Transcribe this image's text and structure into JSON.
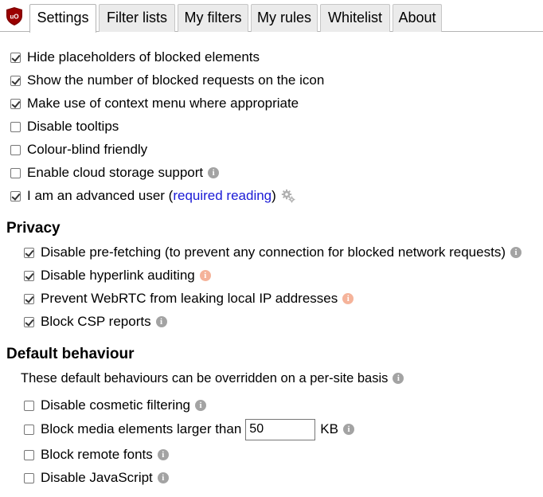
{
  "tabs": [
    {
      "label": "Settings",
      "active": true
    },
    {
      "label": "Filter lists",
      "active": false
    },
    {
      "label": "My filters",
      "active": false
    },
    {
      "label": "My rules",
      "active": false
    },
    {
      "label": "Whitelist",
      "active": false
    },
    {
      "label": "About",
      "active": false
    }
  ],
  "general": [
    {
      "label": "Hide placeholders of blocked elements",
      "checked": true
    },
    {
      "label": "Show the number of blocked requests on the icon",
      "checked": true
    },
    {
      "label": "Make use of context menu where appropriate",
      "checked": true
    },
    {
      "label": "Disable tooltips",
      "checked": false
    },
    {
      "label": "Colour-blind friendly",
      "checked": false
    },
    {
      "label": "Enable cloud storage support",
      "checked": false
    },
    {
      "label": "I am an advanced user (",
      "link": "required reading",
      "suffix": ")",
      "checked": true
    }
  ],
  "privacy": {
    "heading": "Privacy",
    "items": [
      {
        "label": "Disable pre-fetching (to prevent any connection for blocked network requests)",
        "checked": true
      },
      {
        "label": "Disable hyperlink auditing",
        "checked": true
      },
      {
        "label": "Prevent WebRTC from leaking local IP addresses",
        "checked": true
      },
      {
        "label": "Block CSP reports",
        "checked": true
      }
    ]
  },
  "default_behaviour": {
    "heading": "Default behaviour",
    "note": "These default behaviours can be overridden on a per-site basis",
    "items": [
      {
        "label": "Disable cosmetic filtering",
        "checked": false
      },
      {
        "label": "Block media elements larger than",
        "checked": false,
        "value": "50",
        "unit": "KB"
      },
      {
        "label": "Block remote fonts",
        "checked": false
      },
      {
        "label": "Disable JavaScript",
        "checked": false
      }
    ]
  },
  "icons": {
    "info": "info-icon",
    "gear": "gears-icon",
    "logo": "ublock-logo-icon",
    "info_glyph": "i"
  },
  "colors": {
    "link": "#1a1ad6",
    "info_grey": "#a3a3a3",
    "info_warn": "#f5b39a",
    "logo_red": "#800000"
  }
}
